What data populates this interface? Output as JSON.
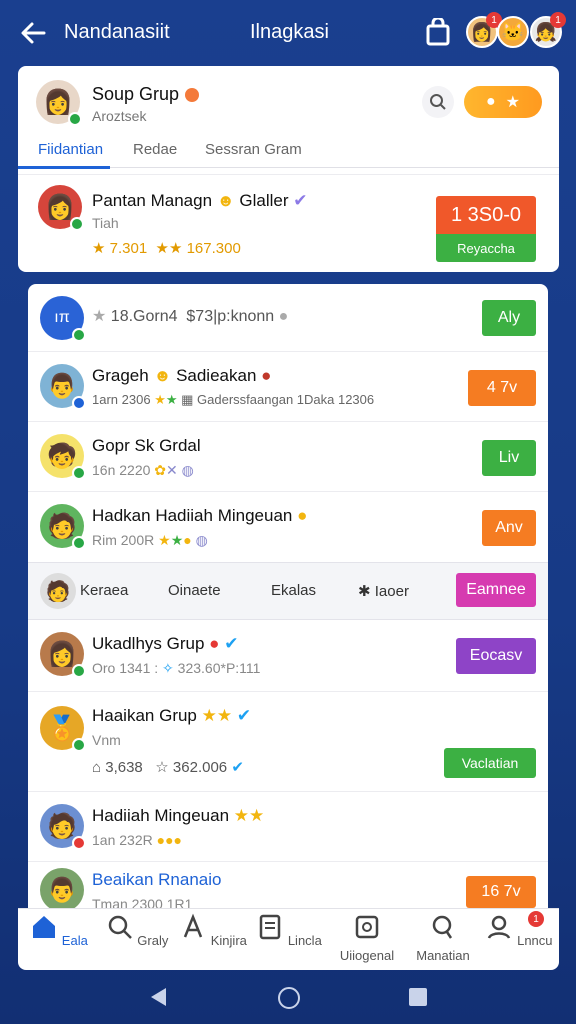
{
  "topbar": {
    "title": "Nandanasiit",
    "center": "Ilnagkasi",
    "badge_count_1": "1",
    "badge_count_2": "1"
  },
  "group": {
    "title": "Soup Grup",
    "subtitle": "Aroztsek",
    "tabs": [
      "Fiidantian",
      "Redae",
      "Sessran Gram"
    ]
  },
  "featured": {
    "name": "Pantan Managn",
    "name_suffix": "Glaller",
    "sub": "Tiah",
    "stat1": "7.301",
    "stat2": "167.300",
    "score": "1 3S0-0",
    "score_label": "Reyaccha"
  },
  "list_header": {
    "rating": "18.Gorn4",
    "info": "$73|p:knonn",
    "action": "Aly"
  },
  "rows": [
    {
      "name": "Grageh",
      "name_suffix": "Sadieakan",
      "sub": "1arn 2306",
      "detail": "Gaderssfaangan 1Daka 12306",
      "action": "4 7v"
    },
    {
      "name": "Gopr Sk Grdal",
      "sub": "16n 2220",
      "action": "Liv"
    },
    {
      "name": "Hadkan Hadiiah Mingeuan",
      "sub": "Rim 200R",
      "action": "Anv"
    }
  ],
  "strip": {
    "items": [
      "Keraea",
      "Oinaete",
      "Ekalas",
      "Iaoer"
    ],
    "action": "Eamnee"
  },
  "rows2": [
    {
      "name": "Ukadlhys Grup",
      "sub": "Oro 1341",
      "detail": "323.60*P:111",
      "action": "Eocasv"
    },
    {
      "name": "Haaikan Grup",
      "sub": "Vnm",
      "stat1": "3,638",
      "stat2": "362.006",
      "action": "Vaclatian"
    },
    {
      "name": "Hadiiah Mingeuan",
      "sub": "1an 232R"
    },
    {
      "name": "Beaikan Rnanaio",
      "sub": "Tman 2300",
      "detail": "1R1",
      "action": "16 7v"
    }
  ],
  "bottom_nav": [
    "Eala",
    "Graly",
    "Kinjira",
    "Lincla",
    "Uiiogenal",
    "Manatian",
    "Lnncu"
  ],
  "nav_badge": "1",
  "colors": {
    "brand": "#1e62d6",
    "bg": "#173a86",
    "green": "#3cb043",
    "orange": "#f57c22"
  }
}
